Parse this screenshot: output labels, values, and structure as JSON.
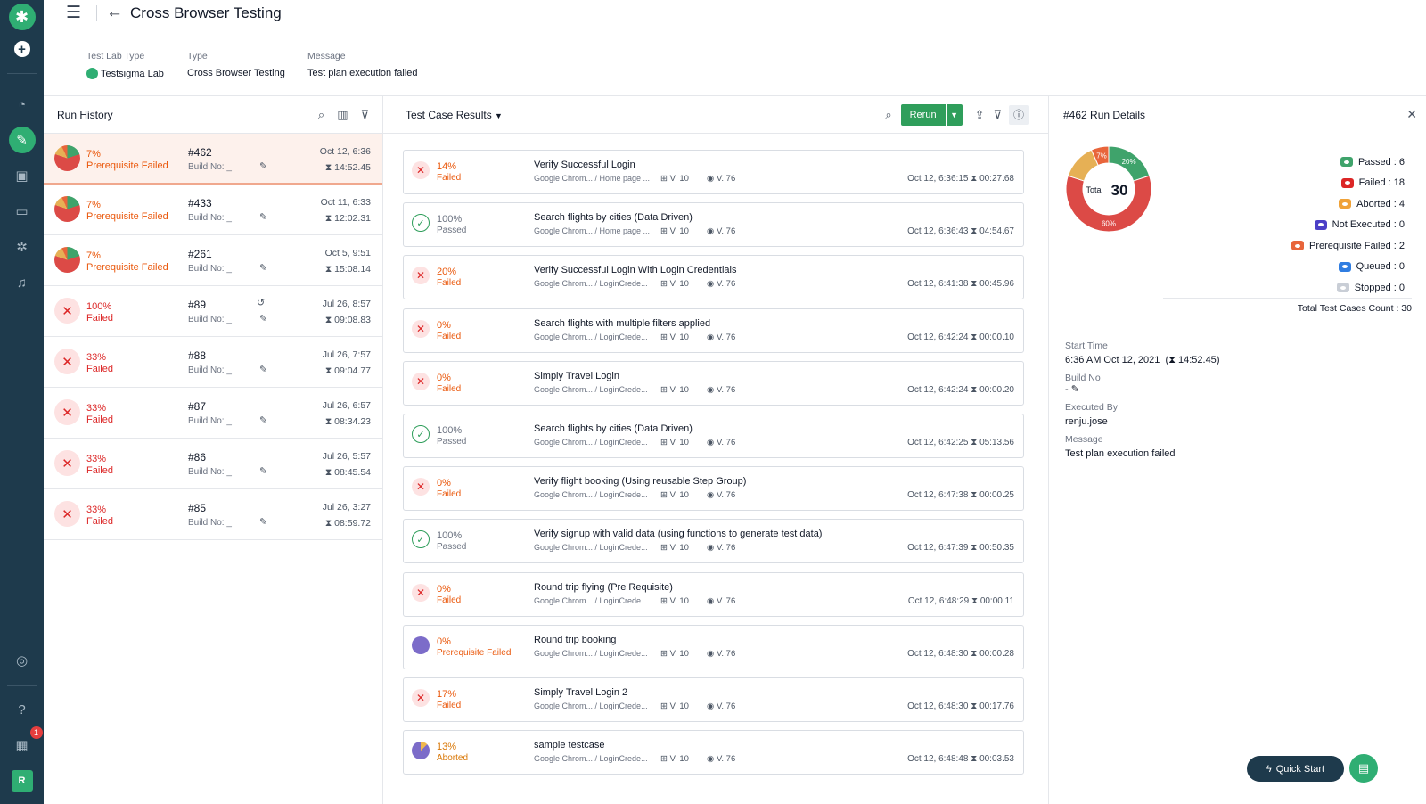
{
  "header": {
    "title": "Cross Browser Testing",
    "meta": [
      {
        "label": "Test Lab Type",
        "value": "Testsigma Lab"
      },
      {
        "label": "Type",
        "value": "Cross Browser Testing"
      },
      {
        "label": "Message",
        "value": "Test plan execution failed"
      }
    ]
  },
  "sidebar": {
    "notification_count": "1",
    "avatar_initial": "R"
  },
  "history": {
    "title": "Run History",
    "build_label": "Build No: _",
    "rows": [
      {
        "pct": "7%",
        "status": "Prerequisite Failed",
        "num": "#462",
        "date": "Oct 12, 6:36",
        "duration": "14:52.45",
        "kind": "pie",
        "selected": true
      },
      {
        "pct": "7%",
        "status": "Prerequisite Failed",
        "num": "#433",
        "date": "Oct 11, 6:33",
        "duration": "12:02.31",
        "kind": "pie"
      },
      {
        "pct": "7%",
        "status": "Prerequisite Failed",
        "num": "#261",
        "date": "Oct 5, 9:51",
        "duration": "15:08.14",
        "kind": "pie"
      },
      {
        "pct": "100%",
        "status": "Failed",
        "num": "#89",
        "date": "Jul 26, 8:57",
        "duration": "09:08.83",
        "kind": "fail",
        "history_icon": true
      },
      {
        "pct": "33%",
        "status": "Failed",
        "num": "#88",
        "date": "Jul 26, 7:57",
        "duration": "09:04.77",
        "kind": "fail"
      },
      {
        "pct": "33%",
        "status": "Failed",
        "num": "#87",
        "date": "Jul 26, 6:57",
        "duration": "08:34.23",
        "kind": "fail"
      },
      {
        "pct": "33%",
        "status": "Failed",
        "num": "#86",
        "date": "Jul 26, 5:57",
        "duration": "08:45.54",
        "kind": "fail"
      },
      {
        "pct": "33%",
        "status": "Failed",
        "num": "#85",
        "date": "Jul 26, 3:27",
        "duration": "08:59.72",
        "kind": "fail"
      }
    ]
  },
  "results": {
    "title": "Test Case Results",
    "rerun_label": "Rerun",
    "os_label": "V. 10",
    "browser_label": "V. 76",
    "cases": [
      {
        "pct": "14%",
        "status": "Failed",
        "kind": "fail",
        "name": "Verify Successful Login",
        "sub": "Google Chrom... / Home page ...",
        "time": "Oct 12, 6:36:15",
        "dur": "00:27.68"
      },
      {
        "pct": "100%",
        "status": "Passed",
        "kind": "pass",
        "name": "Search flights by cities (Data Driven)",
        "sub": "Google Chrom... / Home page ...",
        "time": "Oct 12, 6:36:43",
        "dur": "04:54.67"
      },
      {
        "pct": "20%",
        "status": "Failed",
        "kind": "fail",
        "name": "Verify Successful Login With Login Credentials",
        "sub": "Google Chrom... / LoginCrede...",
        "time": "Oct 12, 6:41:38",
        "dur": "00:45.96"
      },
      {
        "pct": "0%",
        "status": "Failed",
        "kind": "fail",
        "name": "Search flights with multiple filters applied",
        "sub": "Google Chrom... / LoginCrede...",
        "time": "Oct 12, 6:42:24",
        "dur": "00:00.10"
      },
      {
        "pct": "0%",
        "status": "Failed",
        "kind": "fail",
        "name": "Simply Travel Login",
        "sub": "Google Chrom... / LoginCrede...",
        "time": "Oct 12, 6:42:24",
        "dur": "00:00.20"
      },
      {
        "pct": "100%",
        "status": "Passed",
        "kind": "pass",
        "name": "Search flights by cities (Data Driven)",
        "sub": "Google Chrom... / LoginCrede...",
        "time": "Oct 12, 6:42:25",
        "dur": "05:13.56"
      },
      {
        "pct": "0%",
        "status": "Failed",
        "kind": "fail",
        "name": "Verify flight booking (Using reusable Step Group)",
        "sub": "Google Chrom... / LoginCrede...",
        "time": "Oct 12, 6:47:38",
        "dur": "00:00.25"
      },
      {
        "pct": "100%",
        "status": "Passed",
        "kind": "pass",
        "name": "Verify signup with valid data (using functions to generate test data)",
        "sub": "Google Chrom... / LoginCrede...",
        "time": "Oct 12, 6:47:39",
        "dur": "00:50.35"
      },
      {
        "pct": "0%",
        "status": "Failed",
        "kind": "fail",
        "name": "Round trip flying (Pre Requisite)",
        "sub": "Google Chrom... / LoginCrede...",
        "time": "Oct 12, 6:48:29",
        "dur": "00:00.11"
      },
      {
        "pct": "0%",
        "status": "Prerequisite Failed",
        "kind": "pre",
        "name": "Round trip booking",
        "sub": "Google Chrom... / LoginCrede...",
        "time": "Oct 12, 6:48:30",
        "dur": "00:00.28"
      },
      {
        "pct": "17%",
        "status": "Failed",
        "kind": "fail",
        "name": "Simply Travel Login 2",
        "sub": "Google Chrom... / LoginCrede...",
        "time": "Oct 12, 6:48:30",
        "dur": "00:17.76"
      },
      {
        "pct": "13%",
        "status": "Aborted",
        "kind": "abort",
        "name": "sample testcase",
        "sub": "Google Chrom... / LoginCrede...",
        "time": "Oct 12, 6:48:48",
        "dur": "00:03.53"
      }
    ]
  },
  "details": {
    "title": "#462 Run Details",
    "donut": {
      "total_label": "Total",
      "total_value": "30",
      "segments": [
        {
          "name": "Passed",
          "value": 6,
          "color": "#3fa36b",
          "label": "20%"
        },
        {
          "name": "Failed",
          "value": 18,
          "color": "#dc4a46",
          "label": "60%"
        },
        {
          "name": "Aborted",
          "value": 4,
          "color": "#e6b055",
          "label": ""
        },
        {
          "name": "Prerequisite Failed",
          "value": 2,
          "color": "#e8653b",
          "label": "7%"
        }
      ]
    },
    "legend": [
      {
        "text": "Passed : 6",
        "color": "#3fa36b"
      },
      {
        "text": "Failed : 18",
        "color": "#dc2626"
      },
      {
        "text": "Aborted : 4",
        "color": "#f0a238"
      },
      {
        "text": "Not Executed : 0",
        "color": "#4b3fc7"
      },
      {
        "text": "Prerequisite Failed : 2",
        "color": "#e8653b"
      },
      {
        "text": "Queued : 0",
        "color": "#2f7de1"
      },
      {
        "text": "Stopped : 0",
        "color": "#c9ced6"
      }
    ],
    "total_count": "Total Test Cases Count : 30",
    "start_label": "Start Time",
    "start_value": "6:36 AM Oct 12, 2021",
    "start_duration": "14:52.45",
    "build_label": "Build No",
    "build_value": "-",
    "executed_label": "Executed By",
    "executed_value": "renju.jose",
    "message_label": "Message",
    "message_value": "Test plan execution failed"
  },
  "quick_start_label": "Quick Start"
}
